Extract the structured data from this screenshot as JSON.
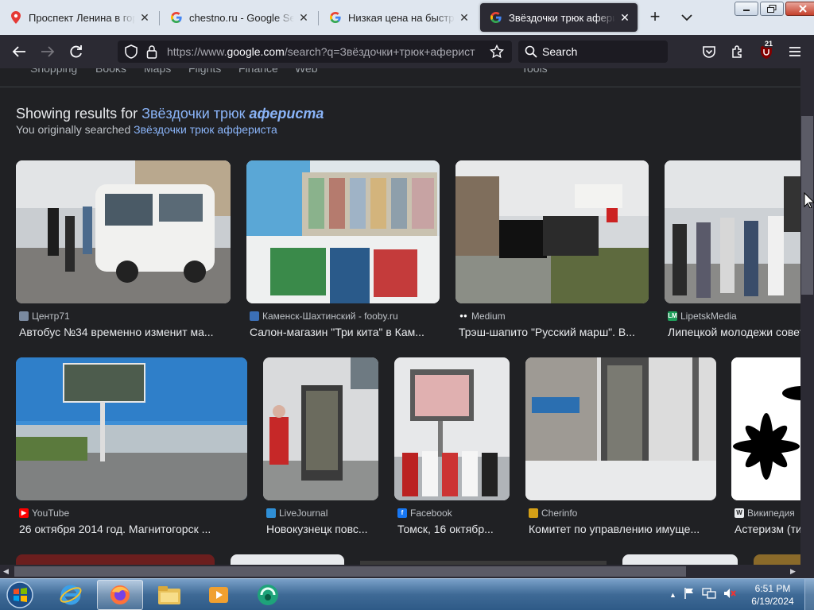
{
  "browser": {
    "tabs": [
      {
        "title": "Проспект Ленина в город",
        "icon": "map-pin-icon",
        "active": false
      },
      {
        "title": "chestno.ru - Google Search",
        "icon": "google-icon",
        "active": false
      },
      {
        "title": "Низкая цена на быстрый",
        "icon": "google-icon",
        "active": false
      },
      {
        "title": "Звёздочки трюк аферис",
        "icon": "google-icon",
        "active": true
      }
    ],
    "url": {
      "prefix": "https://www.",
      "domain": "google.com",
      "rest": "/search?q=Звёздочки+трюк+аферист"
    },
    "search_placeholder": "Search",
    "extension_badge": "21"
  },
  "google": {
    "nav_items": [
      "Shopping",
      "Books",
      "Maps",
      "Flights",
      "Finance",
      "Web",
      "Tools"
    ],
    "showing_prefix": "Showing results for ",
    "showing_query_plain": "Звёздочки трюк ",
    "showing_query_emph": "афериста",
    "orig_prefix": "You originally searched ",
    "orig_query": "Звёздочки трюк афферистa"
  },
  "results": [
    {
      "source": "Центр71",
      "title": "Автобус №34 временно изменит ма...",
      "fav_color": "#7a8aa0"
    },
    {
      "source": "Каменск-Шахтинский - fooby.ru",
      "title": "Салон-магазин \"Три кита\" в Кам...",
      "fav_color": "#3b6fb6"
    },
    {
      "source": "Medium",
      "title": "Трэш-шапито \"Русский марш\". В...",
      "fav_color": "#ffffff"
    },
    {
      "source": "LipetskMedia",
      "title": "Липецкой молодежи советую",
      "fav_color": "#1e9e5a"
    },
    {
      "source": "YouTube",
      "title": "26 октября 2014 год. Магнитогорск ...",
      "fav_color": "#ff0000"
    },
    {
      "source": "LiveJournal",
      "title": "Новокузнецк повс...",
      "fav_color": "#2f8fd6"
    },
    {
      "source": "Facebook",
      "title": "Томск, 16 октябр...",
      "fav_color": "#1877f2"
    },
    {
      "source": "Cherinfo",
      "title": "Комитет по управлению имуще...",
      "fav_color": "#d4a017"
    },
    {
      "source": "Википедия",
      "title": "Астеризм (ти",
      "fav_color": "#e8eaed"
    }
  ],
  "taskbar": {
    "time": "6:51 PM",
    "date": "6/19/2024",
    "apps": [
      "ie-icon",
      "firefox-icon",
      "explorer-icon",
      "media-player-icon",
      "app-icon"
    ]
  }
}
